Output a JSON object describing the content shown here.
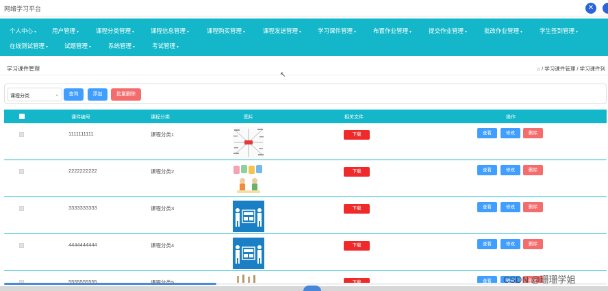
{
  "window": {
    "title": "网络学习平台",
    "close_glyph": "✕"
  },
  "nav": {
    "items": [
      {
        "label": "个人中心",
        "caret": "▾"
      },
      {
        "label": "用户管理",
        "caret": "▾"
      },
      {
        "label": "课程分类管理",
        "caret": "▾"
      },
      {
        "label": "课程信息管理",
        "caret": "▾"
      },
      {
        "label": "课程购买管理",
        "caret": "▾"
      },
      {
        "label": "课程发送管理",
        "caret": "▾"
      },
      {
        "label": "学习课件管理",
        "caret": "▾"
      },
      {
        "label": "布置作业管理",
        "caret": "▾"
      },
      {
        "label": "提交作业管理",
        "caret": "▾"
      },
      {
        "label": "批改作业管理",
        "caret": "▾"
      },
      {
        "label": "学生签到管理",
        "caret": "▾"
      },
      {
        "label": "在线测试管理",
        "caret": "▾"
      },
      {
        "label": "试题管理",
        "caret": "▾"
      },
      {
        "label": "系统管理",
        "caret": "▾"
      },
      {
        "label": "考试管理",
        "caret": "▾"
      }
    ]
  },
  "page": {
    "name": "学习课件管理",
    "breadcrumb": "⌂ / 学习课件管理 / 学习课件列"
  },
  "search": {
    "select_placeholder": "课程分类",
    "select_arrow": "⌄",
    "query_label": "查询",
    "add_label": "添加",
    "batch_delete_label": "批量删除"
  },
  "table": {
    "headers": {
      "code": "课件编号",
      "category": "课程分类",
      "image": "图片",
      "file": "相关文件",
      "actions": "操作"
    },
    "download_label": "下载",
    "view_label": "查看",
    "edit_label": "修改",
    "delete_label": "删除",
    "rows": [
      {
        "code": "1111111111",
        "category": "课程分类1",
        "image": "mindmap"
      },
      {
        "code": "2222222222",
        "category": "课程分类2",
        "image": "abcd"
      },
      {
        "code": "3333333333",
        "category": "课程分类3",
        "image": "english"
      },
      {
        "code": "4444444444",
        "category": "课程分类4",
        "image": "english"
      },
      {
        "code": "5555555555",
        "category": "课程分类5",
        "image": "partial"
      }
    ]
  },
  "watermark": "CSDN @珊珊学姐",
  "colors": {
    "primary": "#13b7c9",
    "button_blue": "#409eff",
    "button_red": "#f56c6c",
    "download_red": "#f02a2a"
  }
}
